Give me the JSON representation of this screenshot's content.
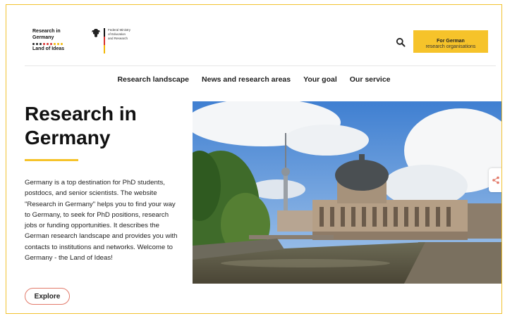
{
  "header": {
    "logo": {
      "line1": "Research in",
      "line2": "Germany",
      "line3": "Land of Ideas",
      "dot_colors": [
        "#222222",
        "#222222",
        "#222222",
        "#d9302c",
        "#d9302c",
        "#d9302c",
        "#f2b705",
        "#f2b705",
        "#f2b705"
      ]
    },
    "ministry": {
      "line1": "Federal Ministry",
      "line2": "of Education",
      "line3": "and Research"
    },
    "search_icon": "search-icon",
    "cta": {
      "line1": "For German",
      "line2": "research organisations"
    }
  },
  "nav": {
    "items": [
      {
        "label": "Research landscape"
      },
      {
        "label": "News and research areas"
      },
      {
        "label": "Your goal"
      },
      {
        "label": "Our service"
      }
    ]
  },
  "hero": {
    "title": "Research in Germany",
    "body": "Germany is a top destination for PhD students, postdocs, and senior scientists. The website \"Research in Germany\" helps you to find your way to Germany, to seek for PhD positions, research jobs or funding opportunities. It describes the German research landscape and provides you with contacts to institutions and networks. Welcome to Germany - the Land of Ideas!",
    "button": "Explore",
    "image_icon": "share-icon"
  },
  "colors": {
    "accent": "#f6c32a",
    "frame": "#f2c230",
    "explore_border": "#e27a6a"
  }
}
